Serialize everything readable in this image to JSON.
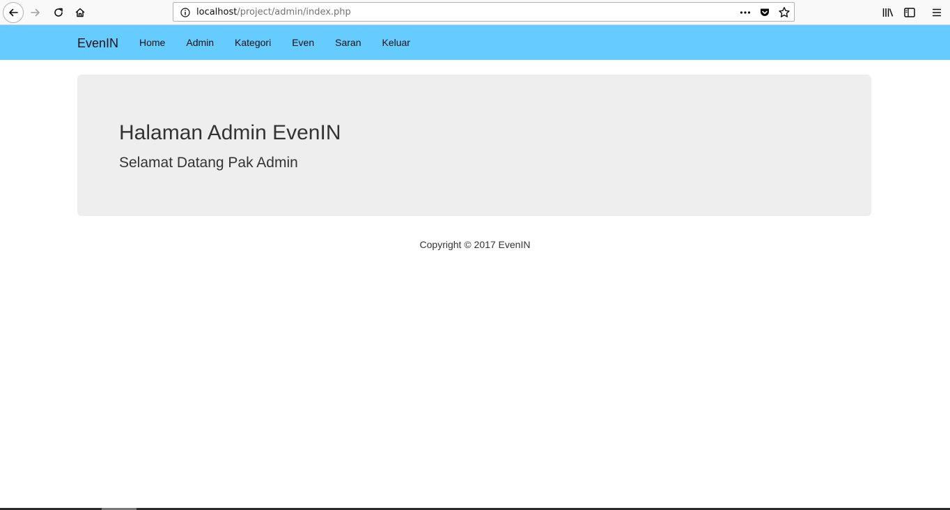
{
  "browser": {
    "url_host": "localhost",
    "url_path": "/project/admin/index.php",
    "icons": [
      "back-icon",
      "forward-icon",
      "reload-icon",
      "home-icon",
      "info-icon",
      "more-icon",
      "pocket-icon",
      "bookmark-star-icon",
      "library-icon",
      "sidebar-icon",
      "menu-icon"
    ]
  },
  "navbar": {
    "brand": "EvenIN",
    "background": "#66ccff",
    "items": [
      {
        "label": "Home"
      },
      {
        "label": "Admin"
      },
      {
        "label": "Kategori"
      },
      {
        "label": "Even"
      },
      {
        "label": "Saran"
      },
      {
        "label": "Keluar"
      }
    ]
  },
  "jumbotron": {
    "title": "Halaman Admin EvenIN",
    "subtitle": "Selamat Datang Pak Admin",
    "background": "#eeeeee"
  },
  "footer": {
    "text": "Copyright © 2017 EvenIN"
  }
}
